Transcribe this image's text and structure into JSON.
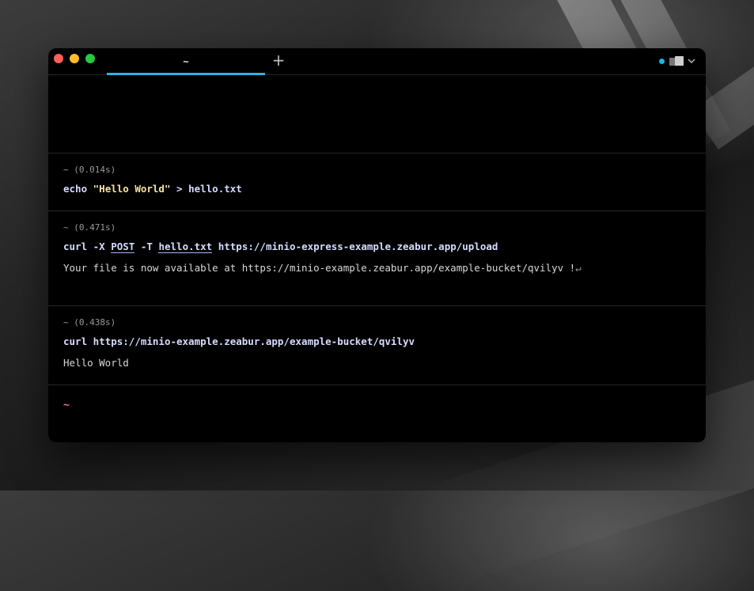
{
  "tab": {
    "title": "~",
    "new_tab_symbol": "+"
  },
  "colors": {
    "accent": "#2bb3e6",
    "status_dot": "#17b5e8",
    "prompt": "#e573b7",
    "string": "#f7e3a1",
    "command": "#d6dcff"
  },
  "icons": [
    "close-dot",
    "minimize-dot",
    "maximize-dot",
    "plus-icon",
    "status-dot-icon",
    "panes-icon",
    "chevron-down-icon",
    "return-icon"
  ],
  "blocks": [
    {
      "meta": "~ (0.014s)",
      "cmd": {
        "prog": "echo",
        "string": "\"Hello World\"",
        "rest": "> hello.txt"
      }
    },
    {
      "meta": "~ (0.471s)",
      "cmd": {
        "prog": "curl",
        "flag1": "-X",
        "method": "POST",
        "flag2": "-T",
        "file": "hello.txt",
        "url": "https://minio-express-example.zeabur.app/upload"
      },
      "output": "Your file is now available at https://minio-example.zeabur.app/example-bucket/qvilyv !",
      "output_return": "↵"
    },
    {
      "meta": "~ (0.438s)",
      "cmd": {
        "prog": "curl",
        "url": "https://minio-example.zeabur.app/example-bucket/qvilyv"
      },
      "output": "Hello World"
    }
  ],
  "prompt": "~"
}
